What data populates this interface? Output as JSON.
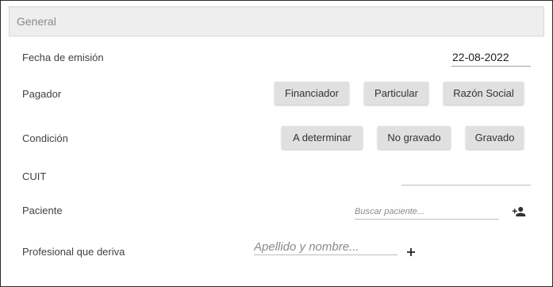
{
  "section": {
    "title": "General"
  },
  "fields": {
    "fecha_label": "Fecha de emisión",
    "fecha_value": "22-08-2022",
    "pagador_label": "Pagador",
    "condicion_label": "Condición",
    "cuit_label": "CUIT",
    "cuit_value": "",
    "paciente_label": "Paciente",
    "paciente_placeholder": "Buscar paciente...",
    "profesional_label": "Profesional que deriva",
    "profesional_placeholder": "Apellido y nombre..."
  },
  "pagador_options": [
    "Financiador",
    "Particular",
    "Razón Social"
  ],
  "condicion_options": [
    "A determinar",
    "No gravado",
    "Gravado"
  ],
  "icons": {
    "add_patient": "person-add-icon",
    "add_professional": "plus-icon"
  },
  "colors": {
    "header_bg": "#eeeeee",
    "button_bg": "#e0e0e0"
  }
}
